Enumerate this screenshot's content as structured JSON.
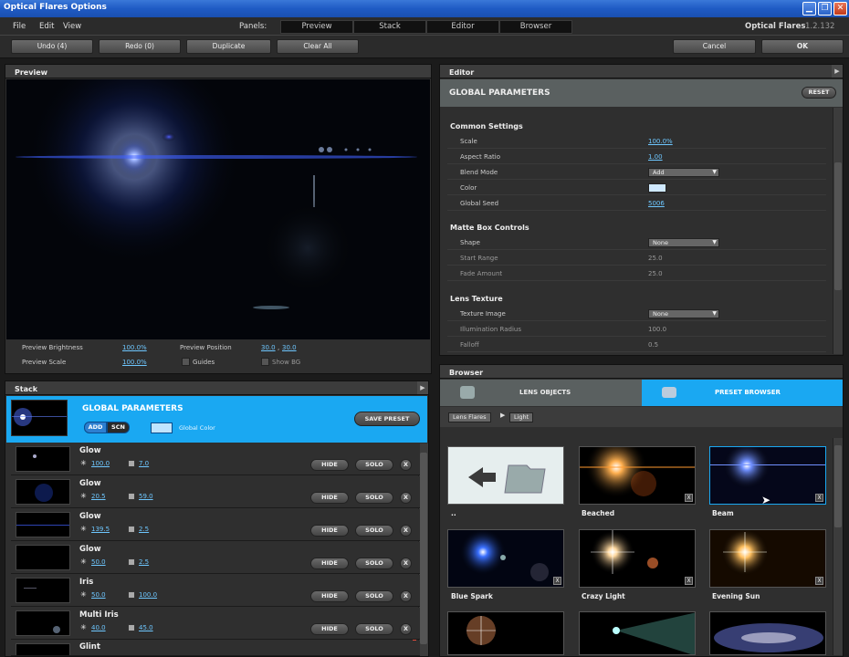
{
  "window": {
    "title": "Optical Flares Options",
    "minimize": "▁",
    "restore": "❐",
    "close": "✕"
  },
  "menu": {
    "file": "File",
    "edit": "Edit",
    "view": "View",
    "panels_label": "Panels:",
    "panels": [
      "Preview",
      "Stack",
      "Editor",
      "Browser"
    ],
    "brand": "Optical Flares",
    "version": "1.2.132"
  },
  "toolbar": {
    "undo": "Undo (4)",
    "redo": "Redo (0)",
    "duplicate": "Duplicate",
    "clear_all": "Clear All",
    "cancel": "Cancel",
    "ok": "OK"
  },
  "preview": {
    "title": "Preview",
    "brightness_label": "Preview Brightness",
    "brightness": "100.0%",
    "scale_label": "Preview Scale",
    "scale": "100.0%",
    "position_label": "Preview Position",
    "position_x": "30.0",
    "position_sep": ",",
    "position_y": "30.0",
    "guides_label": "Guides",
    "showbg_label": "Show BG"
  },
  "editor": {
    "title": "Editor",
    "header": "GLOBAL PARAMETERS",
    "reset": "RESET",
    "common": {
      "title": "Common Settings",
      "scale_label": "Scale",
      "scale": "100.0%",
      "aspect_label": "Aspect Ratio",
      "aspect": "1.00",
      "blend_label": "Blend Mode",
      "blend": "Add",
      "color_label": "Color",
      "color": "#cfe9ff",
      "seed_label": "Global Seed",
      "seed": "5006"
    },
    "matte": {
      "title": "Matte Box Controls",
      "shape_label": "Shape",
      "shape": "None",
      "start_label": "Start Range",
      "start": "25.0",
      "fade_label": "Fade Amount",
      "fade": "25.0"
    },
    "texture": {
      "title": "Lens Texture",
      "image_label": "Texture Image",
      "image": "None",
      "illum_label": "Illumination Radius",
      "illum": "100.0",
      "falloff_label": "Falloff",
      "falloff": "0.5"
    }
  },
  "stack": {
    "title": "Stack",
    "global_title": "GLOBAL PARAMETERS",
    "add": "ADD",
    "scn": "SCN",
    "global_color_label": "Global Color",
    "global_color": "#bfe4ff",
    "save_preset": "SAVE PRESET",
    "hide": "HIDE",
    "solo": "SOLO",
    "remove": "X",
    "layers": [
      {
        "name": "Glow",
        "v1": "100.0",
        "v2": "7.0"
      },
      {
        "name": "Glow",
        "v1": "20.5",
        "v2": "59.0"
      },
      {
        "name": "Glow",
        "v1": "139.5",
        "v2": "2.5"
      },
      {
        "name": "Glow",
        "v1": "50.0",
        "v2": "2.5"
      },
      {
        "name": "Iris",
        "v1": "50.0",
        "v2": "100.0"
      },
      {
        "name": "Multi Iris",
        "v1": "40.0",
        "v2": "45.0"
      },
      {
        "name": "Glint",
        "v1": "",
        "v2": ""
      }
    ]
  },
  "browser": {
    "title": "Browser",
    "lens_objects": "LENS OBJECTS",
    "preset_browser": "PRESET BROWSER",
    "crumb1": "Lens Flares",
    "crumb2": "Light",
    "tiles": [
      {
        "label": "..",
        "remove": ""
      },
      {
        "label": "Beached",
        "remove": "X"
      },
      {
        "label": "Beam",
        "remove": "X"
      },
      {
        "label": "Blue Spark",
        "remove": "X"
      },
      {
        "label": "Crazy Light",
        "remove": "X"
      },
      {
        "label": "Evening Sun",
        "remove": "X"
      }
    ]
  }
}
